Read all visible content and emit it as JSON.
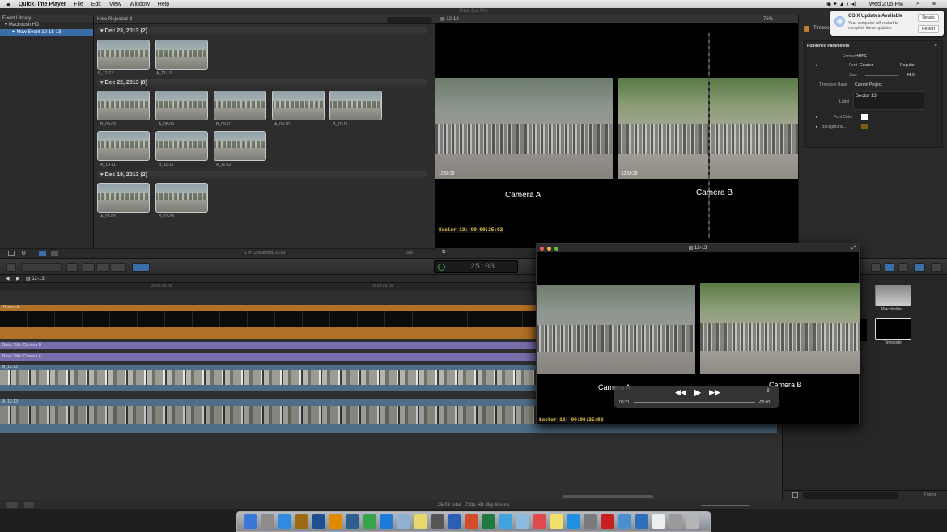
{
  "menubar": {
    "apple": "",
    "app_name": "QuickTime Player",
    "items": [
      "File",
      "Edit",
      "View",
      "Window",
      "Help"
    ],
    "clock": "Wed 2:05 PM"
  },
  "window_title": "Final Cut Pro",
  "library": {
    "header": "Event Library",
    "items": [
      {
        "label": "Macintosh HD",
        "selected": false
      },
      {
        "label": "New Event 12-18-13",
        "selected": true
      }
    ]
  },
  "browser": {
    "filter_label": "Hide Rejected",
    "groups": [
      {
        "date": "Dec 23, 2013",
        "count": "(2)",
        "clips": [
          "B_12-13",
          "A_12-13"
        ]
      },
      {
        "date": "Dec 22, 2013",
        "count": "(8)",
        "clips": [
          "B_08-09",
          "A_08-09",
          "B_09-10",
          "A_09-10",
          "B_10-11",
          "A_10-11",
          "B_11-12",
          "A_11-12"
        ]
      },
      {
        "date": "Dec 19, 2013",
        "count": "(2)",
        "clips": [
          "A_07-08",
          "B_07-08"
        ]
      }
    ],
    "status": "1 of 12 selected, 26:03",
    "duration_setting": "30s"
  },
  "viewer": {
    "project_name": "12-13",
    "zoom": "76%",
    "camera_a_label": "Camera A",
    "camera_b_label": "Camera B",
    "frame_tc": "12:59:29",
    "sector_text": "Sector 13: 00:00:25:02"
  },
  "notification": {
    "title": "OS X Updates Available",
    "body": "Your computer will restart to complete these updates.",
    "details_label": "Details",
    "restart_label": "Restart"
  },
  "inspector": {
    "title": "Timecode",
    "section": "Published Parameters",
    "format_label": "Format",
    "format_value": "HMSF",
    "font_label": "Font",
    "font_value": "Courier",
    "font_style": "Regular",
    "size_label": "Size",
    "size_value": "44.0",
    "timecode_base_label": "Timecode Base",
    "timecode_base_value": "Current Project",
    "label_label": "Label",
    "label_value": "Sector 13:",
    "font_color_label": "Font Color",
    "background_label": "Background..."
  },
  "toolbar": {
    "timecode": "25:03"
  },
  "timeline": {
    "project": "12-13",
    "ruler_marks": [
      "00:00:22:00",
      "00:00:23:00"
    ],
    "tracks": {
      "timecode": "Timecode",
      "title_b": "Basic Title: Camera B",
      "title_a": "Basic Title: Camera A",
      "clip_b": "B_12-13",
      "clip_a": "A_12-13"
    }
  },
  "effects": {
    "items": [
      "Placeholder",
      "Timecode"
    ],
    "count": "4 items"
  },
  "statusbar": {
    "text": "25:03 total - 720p HD 25p Stereo"
  },
  "qt_window": {
    "title": "12-13",
    "camera_a_label": "Camera A",
    "camera_b_label": "Camera B",
    "sector_text": "Sector 13: 00:00:25:02",
    "elapsed": "00:21",
    "remaining": "-00:00"
  },
  "dock": {
    "icons": [
      "finder-icon",
      "launchpad-icon",
      "safari-icon",
      "bridge-icon",
      "photoshop-icon",
      "illustrator-icon",
      "lightroom-icon",
      "maps-icon",
      "browser-icon",
      "mail-icon",
      "notes-icon",
      "movie-icon",
      "word-icon",
      "powerpoint-icon",
      "excel-icon",
      "itunes-icon",
      "preview-icon",
      "calendar-icon",
      "stickies-icon",
      "appstore-icon",
      "settings-icon",
      "acrobat-icon",
      "network-icon",
      "quicktime-icon",
      "document-icon",
      "screenshot-icon",
      "trash-icon"
    ]
  },
  "colors": {
    "selection_blue": "#3b6ea8",
    "timecode_track": "#b07025",
    "title_track": "#7a6dad",
    "sector_yellow": "#e8c54a"
  }
}
